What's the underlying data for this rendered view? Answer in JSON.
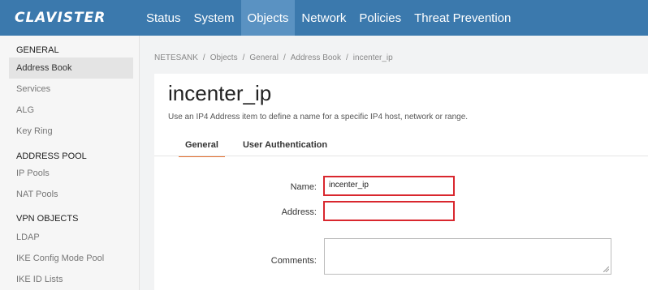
{
  "brand": {
    "logo_text": "CLAVISTER"
  },
  "nav": {
    "items": [
      {
        "label": "Status"
      },
      {
        "label": "System"
      },
      {
        "label": "Objects",
        "active": true
      },
      {
        "label": "Network"
      },
      {
        "label": "Policies"
      },
      {
        "label": "Threat Prevention"
      }
    ]
  },
  "sidebar": {
    "general": {
      "heading": "GENERAL",
      "items": [
        "Address Book",
        "Services",
        "ALG",
        "Key Ring"
      ]
    },
    "address_pool": {
      "heading": "ADDRESS POOL",
      "items": [
        "IP Pools",
        "NAT Pools"
      ]
    },
    "vpn_objects": {
      "heading": "VPN OBJECTS",
      "items": [
        "LDAP",
        "IKE Config Mode Pool",
        "IKE ID Lists"
      ]
    }
  },
  "breadcrumb": [
    "NETESANK",
    "Objects",
    "General",
    "Address Book",
    "incenter_ip"
  ],
  "page": {
    "title": "incenter_ip",
    "description": "Use an IP4 Address item to define a name for a specific IP4 host, network or range."
  },
  "tabs": [
    {
      "label": "General",
      "active": true
    },
    {
      "label": "User Authentication"
    }
  ],
  "form": {
    "name_label": "Name:",
    "name_value": "incenter_ip",
    "address_label": "Address:",
    "address_value": "",
    "comments_label": "Comments:"
  },
  "colors": {
    "topbar": "#3b79ad",
    "nav_active": "#5a92c2",
    "highlight_border": "#d9272e",
    "tab_underline": "#e36e2d"
  }
}
